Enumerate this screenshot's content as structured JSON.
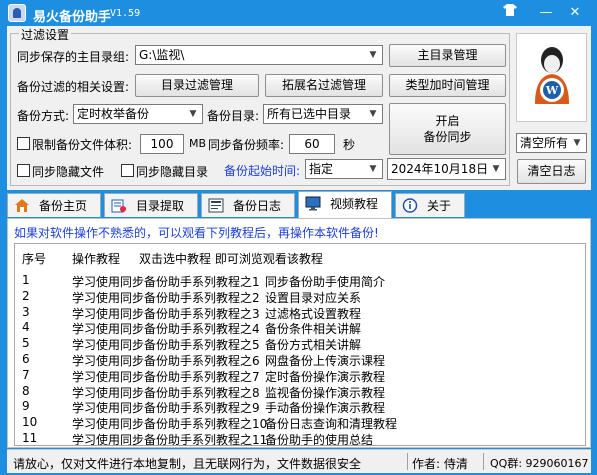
{
  "window": {
    "title": "易火备份助手",
    "version": "V1.59"
  },
  "settings": {
    "group_title": "过滤设置",
    "main_dir_label": "同步保存的主目录组:",
    "main_dir_value": "G:\\监视\\",
    "filter_label": "备份过滤的相关设置:",
    "dir_filter_btn": "目录过滤管理",
    "ext_filter_btn": "拓展名过滤管理",
    "main_dir_btn": "主目录管理",
    "type_time_btn": "类型加时间管理",
    "mode_label": "备份方式:",
    "mode_value": "定时枚举备份",
    "dir_label": "备份目录:",
    "dir_value": "所有已选中目录",
    "limit_size_label": "限制备份文件体积:",
    "limit_size_value": "100",
    "limit_size_unit": "MB",
    "freq_label": "同步备份频率:",
    "freq_value": "60",
    "freq_unit": "秒",
    "hide_file_label": "同步隐藏文件",
    "hide_dir_label": "同步隐藏目录",
    "start_time_label": "备份起始时间:",
    "start_time_mode": "指定",
    "start_date": "2024年10月18日",
    "start_btn_line1": "开启",
    "start_btn_line2": "备份同步",
    "clear_select": "清空所有",
    "clear_log_btn": "清空日志"
  },
  "tabs": [
    {
      "label": "备份主页",
      "icon": "home-icon"
    },
    {
      "label": "目录提取",
      "icon": "folder-list-icon"
    },
    {
      "label": "备份日志",
      "icon": "log-icon"
    },
    {
      "label": "视频教程",
      "icon": "monitor-icon",
      "active": true
    },
    {
      "label": "关于",
      "icon": "info-icon"
    }
  ],
  "tutorial": {
    "notice": "如果对软件操作不熟悉的，可以观看下列教程后，再操作本软件备份!",
    "col_seq": "序号",
    "col_op": "操作教程",
    "col_hint": "双击选中教程  即可浏览观看该教程",
    "rows": [
      {
        "seq": "1",
        "title": "学习使用同步备份助手系列教程之1",
        "desc": "同步备份助手使用简介"
      },
      {
        "seq": "2",
        "title": "学习使用同步备份助手系列教程之2",
        "desc": "设置目录对应关系"
      },
      {
        "seq": "3",
        "title": "学习使用同步备份助手系列教程之3",
        "desc": "过滤格式设置教程"
      },
      {
        "seq": "4",
        "title": "学习使用同步备份助手系列教程之4",
        "desc": "备份条件相关讲解"
      },
      {
        "seq": "5",
        "title": "学习使用同步备份助手系列教程之5",
        "desc": "备份方式相关讲解"
      },
      {
        "seq": "6",
        "title": "学习使用同步备份助手系列教程之6",
        "desc": "网盘备份上传演示课程"
      },
      {
        "seq": "7",
        "title": "学习使用同步备份助手系列教程之7",
        "desc": "定时备份操作演示教程"
      },
      {
        "seq": "8",
        "title": "学习使用同步备份助手系列教程之8",
        "desc": "监视备份操作演示教程"
      },
      {
        "seq": "9",
        "title": "学习使用同步备份助手系列教程之9",
        "desc": "手动备份操作演示教程"
      },
      {
        "seq": "10",
        "title": "学习使用同步备份助手系列教程之10",
        "desc": "备份日志查询和清理教程"
      },
      {
        "seq": "11",
        "title": "学习使用同步备份助手系列教程之11",
        "desc": "备份助手的使用总结"
      }
    ]
  },
  "status": {
    "message": "请放心，仅对文件进行本地复制，且无联网行为，文件数据很安全",
    "author": "作者: 侍清",
    "qq": "QQ群: 929060167"
  }
}
